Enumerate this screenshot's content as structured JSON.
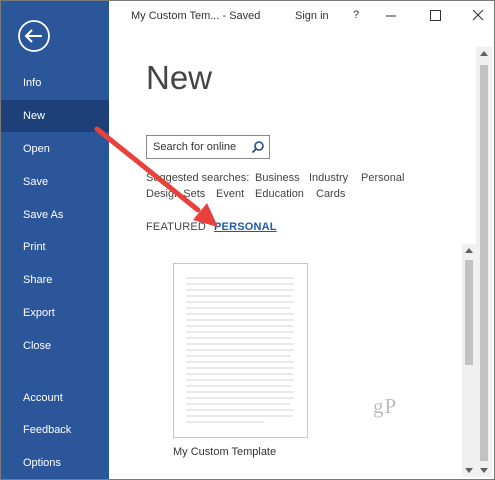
{
  "window": {
    "title": "My Custom Tem...  -  Saved",
    "signin_label": "Sign in",
    "help_label": "?"
  },
  "sidebar": {
    "items": [
      {
        "label": "Info"
      },
      {
        "label": "New",
        "active": true
      },
      {
        "label": "Open"
      },
      {
        "label": "Save"
      },
      {
        "label": "Save As"
      },
      {
        "label": "Print"
      },
      {
        "label": "Share"
      },
      {
        "label": "Export"
      },
      {
        "label": "Close"
      },
      {
        "label": "Account"
      },
      {
        "label": "Feedback"
      },
      {
        "label": "Options"
      }
    ],
    "bg_color": "#2b579a",
    "active_color": "#1d4079"
  },
  "main": {
    "title": "New",
    "search": {
      "placeholder": "Search for online"
    },
    "suggested": {
      "label": "Suggested searches:",
      "items": [
        "Business",
        "Industry",
        "Personal",
        "Design Sets",
        "Event",
        "Education",
        "Cards"
      ]
    },
    "tabs": {
      "featured": "FEATURED",
      "personal": "PERSONAL"
    },
    "template": {
      "name": "My Custom Template"
    },
    "watermark": "gP"
  },
  "colors": {
    "accent": "#1e5aa8",
    "arrow": "#e8403a"
  }
}
